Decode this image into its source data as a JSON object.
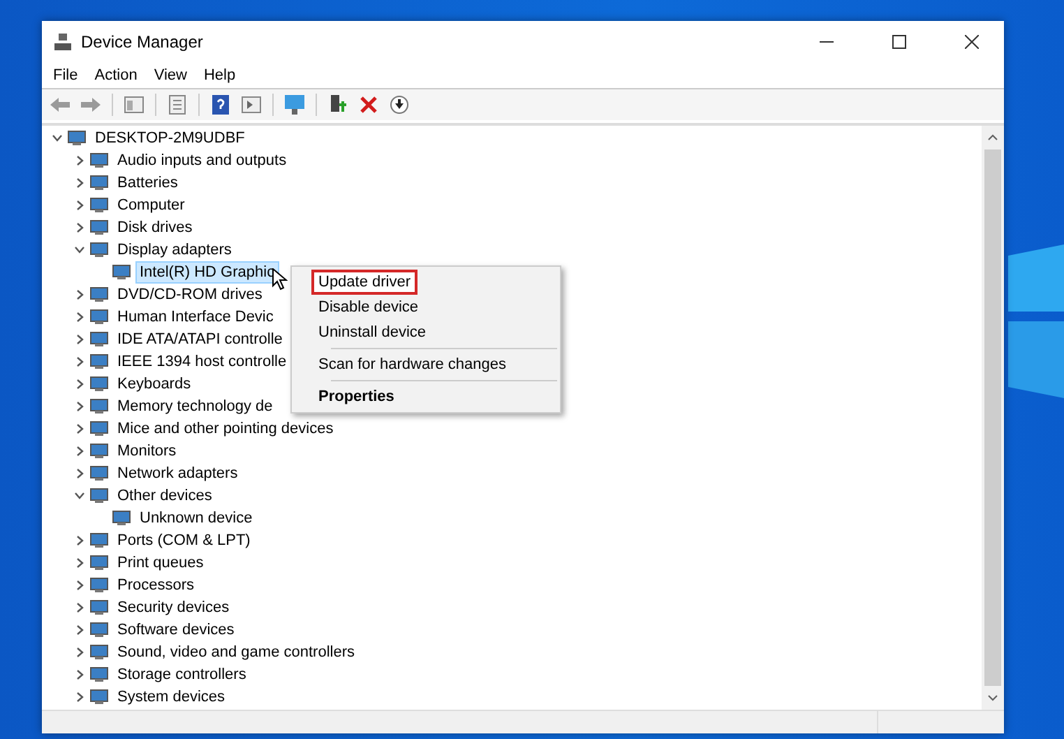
{
  "window": {
    "title": "Device Manager"
  },
  "menu": [
    "File",
    "Action",
    "View",
    "Help"
  ],
  "tree": {
    "label": "DESKTOP-2M9UDBF",
    "expanded": true,
    "children": [
      {
        "label": "Audio inputs and outputs",
        "expanded": false,
        "selected": false
      },
      {
        "label": "Batteries",
        "expanded": false,
        "selected": false
      },
      {
        "label": "Computer",
        "expanded": false,
        "selected": false
      },
      {
        "label": "Disk drives",
        "expanded": false,
        "selected": false
      },
      {
        "label": "Display adapters",
        "expanded": true,
        "selected": false,
        "children": [
          {
            "label": "Intel(R) HD Graphic",
            "selected": true
          }
        ]
      },
      {
        "label": "DVD/CD-ROM drives",
        "expanded": false,
        "selected": false
      },
      {
        "label": "Human Interface Devic",
        "expanded": false,
        "selected": false
      },
      {
        "label": "IDE ATA/ATAPI controlle",
        "expanded": false,
        "selected": false
      },
      {
        "label": "IEEE 1394 host controlle",
        "expanded": false,
        "selected": false
      },
      {
        "label": "Keyboards",
        "expanded": false,
        "selected": false
      },
      {
        "label": "Memory technology de",
        "expanded": false,
        "selected": false
      },
      {
        "label": "Mice and other pointing devices",
        "expanded": false,
        "selected": false
      },
      {
        "label": "Monitors",
        "expanded": false,
        "selected": false
      },
      {
        "label": "Network adapters",
        "expanded": false,
        "selected": false
      },
      {
        "label": "Other devices",
        "expanded": true,
        "selected": false,
        "children": [
          {
            "label": "Unknown device",
            "selected": false
          }
        ]
      },
      {
        "label": "Ports (COM & LPT)",
        "expanded": false,
        "selected": false
      },
      {
        "label": "Print queues",
        "expanded": false,
        "selected": false
      },
      {
        "label": "Processors",
        "expanded": false,
        "selected": false
      },
      {
        "label": "Security devices",
        "expanded": false,
        "selected": false
      },
      {
        "label": "Software devices",
        "expanded": false,
        "selected": false
      },
      {
        "label": "Sound, video and game controllers",
        "expanded": false,
        "selected": false
      },
      {
        "label": "Storage controllers",
        "expanded": false,
        "selected": false
      },
      {
        "label": "System devices",
        "expanded": false,
        "selected": false
      }
    ]
  },
  "context_menu": [
    {
      "kind": "item",
      "label": "Update driver",
      "selected": true
    },
    {
      "kind": "item",
      "label": "Disable device",
      "selected": false
    },
    {
      "kind": "item",
      "label": "Uninstall device",
      "selected": false
    },
    {
      "kind": "separator"
    },
    {
      "kind": "item",
      "label": "Scan for hardware changes",
      "selected": false
    },
    {
      "kind": "separator"
    },
    {
      "kind": "bold",
      "label": "Properties",
      "selected": false
    }
  ]
}
